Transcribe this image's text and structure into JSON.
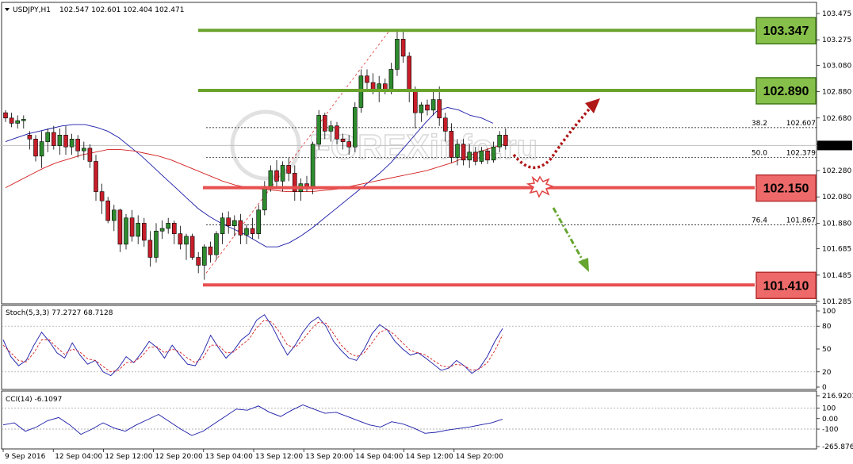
{
  "chart_data": {
    "type": "candlestick",
    "main": {
      "symbol_header": "USDJPY,H1",
      "ohlc_header": "102.547 102.601 102.404 102.471",
      "current_price": "102.471",
      "ylim": [
        101.285,
        103.475
      ],
      "y_ticks": [
        "103.475",
        "103.275",
        "103.080",
        "102.880",
        "102.680",
        "102.480",
        "102.280",
        "102.080",
        "101.880",
        "101.685",
        "101.485",
        "101.285"
      ],
      "candles": [
        [
          102.72,
          102.74,
          102.65,
          102.68
        ],
        [
          102.68,
          102.72,
          102.61,
          102.64
        ],
        [
          102.64,
          102.7,
          102.6,
          102.66
        ],
        [
          102.66,
          102.7,
          102.6,
          102.67
        ],
        [
          102.55,
          102.58,
          102.44,
          102.52
        ],
        [
          102.52,
          102.55,
          102.35,
          102.39
        ],
        [
          102.39,
          102.58,
          102.3,
          102.5
        ],
        [
          102.5,
          102.6,
          102.42,
          102.57
        ],
        [
          102.57,
          102.62,
          102.44,
          102.47
        ],
        [
          102.47,
          102.6,
          102.4,
          102.55
        ],
        [
          102.55,
          102.62,
          102.4,
          102.46
        ],
        [
          102.46,
          102.56,
          102.4,
          102.52
        ],
        [
          102.52,
          102.55,
          102.38,
          102.43
        ],
        [
          102.43,
          102.5,
          102.36,
          102.45
        ],
        [
          102.45,
          102.48,
          102.3,
          102.35
        ],
        [
          102.35,
          102.4,
          102.05,
          102.12
        ],
        [
          102.12,
          102.18,
          101.95,
          102.05
        ],
        [
          102.05,
          102.08,
          101.88,
          101.9
        ],
        [
          101.9,
          102.02,
          101.82,
          101.98
        ],
        [
          101.98,
          101.99,
          101.66,
          101.72
        ],
        [
          101.72,
          101.95,
          101.68,
          101.92
        ],
        [
          101.92,
          101.98,
          101.74,
          101.78
        ],
        [
          101.78,
          101.94,
          101.72,
          101.88
        ],
        [
          101.88,
          101.92,
          101.7,
          101.75
        ],
        [
          101.75,
          101.82,
          101.55,
          101.62
        ],
        [
          101.62,
          101.88,
          101.58,
          101.82
        ],
        [
          101.82,
          101.9,
          101.76,
          101.84
        ],
        [
          101.84,
          101.92,
          101.8,
          101.88
        ],
        [
          101.88,
          101.9,
          101.72,
          101.8
        ],
        [
          101.8,
          101.86,
          101.68,
          101.72
        ],
        [
          101.72,
          101.8,
          101.6,
          101.78
        ],
        [
          101.78,
          101.8,
          101.6,
          101.62
        ],
        [
          101.62,
          101.66,
          101.5,
          101.56
        ],
        [
          101.56,
          101.72,
          101.45,
          101.7
        ],
        [
          101.7,
          101.74,
          101.58,
          101.64
        ],
        [
          101.64,
          101.82,
          101.6,
          101.8
        ],
        [
          101.8,
          101.96,
          101.72,
          101.92
        ],
        [
          101.92,
          101.97,
          101.8,
          101.86
        ],
        [
          101.86,
          101.94,
          101.78,
          101.9
        ],
        [
          101.9,
          101.95,
          101.72,
          101.79
        ],
        [
          101.79,
          101.87,
          101.72,
          101.84
        ],
        [
          101.84,
          101.92,
          101.76,
          101.8
        ],
        [
          101.8,
          102.02,
          101.76,
          101.98
        ],
        [
          101.98,
          102.2,
          101.94,
          102.16
        ],
        [
          102.16,
          102.32,
          102.12,
          102.28
        ],
        [
          102.28,
          102.36,
          102.14,
          102.2
        ],
        [
          102.2,
          102.35,
          102.12,
          102.32
        ],
        [
          102.32,
          102.38,
          102.2,
          102.26
        ],
        [
          102.26,
          102.32,
          102.05,
          102.12
        ],
        [
          102.12,
          102.22,
          102.05,
          102.18
        ],
        [
          102.18,
          102.24,
          102.12,
          102.14
        ],
        [
          102.14,
          102.5,
          102.1,
          102.48
        ],
        [
          102.48,
          102.74,
          102.44,
          102.7
        ],
        [
          102.7,
          102.72,
          102.52,
          102.58
        ],
        [
          102.58,
          102.66,
          102.5,
          102.62
        ],
        [
          102.62,
          102.65,
          102.48,
          102.52
        ],
        [
          102.52,
          102.56,
          102.44,
          102.5
        ],
        [
          102.5,
          102.55,
          102.4,
          102.46
        ],
        [
          102.46,
          102.8,
          102.42,
          102.76
        ],
        [
          102.76,
          103.05,
          102.72,
          103.0
        ],
        [
          103.0,
          103.05,
          102.9,
          102.95
        ],
        [
          102.95,
          103.02,
          102.86,
          102.88
        ],
        [
          102.88,
          103.0,
          102.8,
          102.94
        ],
        [
          102.94,
          102.98,
          102.86,
          102.9
        ],
        [
          102.9,
          103.1,
          102.86,
          103.05
        ],
        [
          103.05,
          103.35,
          103.0,
          103.28
        ],
        [
          103.28,
          103.35,
          103.1,
          103.15
        ],
        [
          103.15,
          103.18,
          102.8,
          102.9
        ],
        [
          102.9,
          102.92,
          102.6,
          102.72
        ],
        [
          102.72,
          102.8,
          102.65,
          102.78
        ],
        [
          102.78,
          102.82,
          102.7,
          102.74
        ],
        [
          102.74,
          102.88,
          102.7,
          102.82
        ],
        [
          102.82,
          102.92,
          102.62,
          102.68
        ],
        [
          102.68,
          102.72,
          102.5,
          102.58
        ],
        [
          102.58,
          102.64,
          102.34,
          102.38
        ],
        [
          102.38,
          102.52,
          102.32,
          102.48
        ],
        [
          102.48,
          102.52,
          102.32,
          102.36
        ],
        [
          102.36,
          102.48,
          102.3,
          102.42
        ],
        [
          102.42,
          102.46,
          102.32,
          102.35
        ],
        [
          102.35,
          102.46,
          102.33,
          102.43
        ],
        [
          102.43,
          102.45,
          102.33,
          102.36
        ],
        [
          102.36,
          102.5,
          102.34,
          102.46
        ],
        [
          102.46,
          102.58,
          102.42,
          102.55
        ],
        [
          102.55,
          102.6,
          102.44,
          102.47
        ]
      ],
      "ma_blue": [
        102.5,
        102.53,
        102.56,
        102.58,
        102.6,
        102.62,
        102.63,
        102.63,
        102.61,
        102.58,
        102.53,
        102.46,
        102.39,
        102.31,
        102.23,
        102.15,
        102.07,
        101.99,
        101.93,
        101.88,
        101.84,
        101.8,
        101.75,
        101.7,
        101.7,
        101.73,
        101.78,
        101.84,
        101.91,
        101.98,
        102.05,
        102.12,
        102.19,
        102.26,
        102.34,
        102.44,
        102.54,
        102.64,
        102.73,
        102.76,
        102.74,
        102.7,
        102.68,
        102.64
      ],
      "ma_red": [
        102.15,
        102.2,
        102.25,
        102.3,
        102.34,
        102.37,
        102.4,
        102.42,
        102.44,
        102.44,
        102.43,
        102.41,
        102.39,
        102.36,
        102.32,
        102.28,
        102.24,
        102.2,
        102.17,
        102.15,
        102.14,
        102.13,
        102.12,
        102.12,
        102.12,
        102.13,
        102.14,
        102.16,
        102.18,
        102.2,
        102.22,
        102.24,
        102.26,
        102.28,
        102.31,
        102.34,
        102.38,
        102.42,
        102.45,
        102.48
      ],
      "levels": [
        {
          "label": "103.347",
          "value": 103.347,
          "kind": "resistance",
          "color": "#6aa32c"
        },
        {
          "label": "102.890",
          "value": 102.89,
          "kind": "resistance",
          "color": "#6aa32c"
        },
        {
          "label": "102.150",
          "value": 102.15,
          "kind": "support",
          "color": "#e85050"
        },
        {
          "label": "101.410",
          "value": 101.41,
          "kind": "support",
          "color": "#e85050"
        }
      ],
      "fib_levels": [
        {
          "ratio": "38.2",
          "price": "102.607",
          "value": 102.607
        },
        {
          "ratio": "50.0",
          "price": "102.379",
          "value": 102.379
        },
        {
          "ratio": "76.4",
          "price": "101.867",
          "value": 101.867
        }
      ],
      "watermark": "FOREXinfo.ru"
    },
    "stoch": {
      "label": "Stoch(5,3,3) 77.2727 68.7128",
      "ylim": [
        0,
        100
      ],
      "y_ticks": [
        "100",
        "80",
        "50",
        "20",
        "0"
      ],
      "main_line": [
        62,
        40,
        28,
        35,
        55,
        72,
        60,
        45,
        38,
        58,
        42,
        30,
        35,
        20,
        15,
        25,
        40,
        32,
        45,
        60,
        52,
        38,
        55,
        42,
        30,
        28,
        45,
        68,
        52,
        38,
        48,
        62,
        70,
        88,
        95,
        80,
        60,
        42,
        55,
        72,
        85,
        92,
        80,
        60,
        48,
        38,
        35,
        50,
        70,
        82,
        75,
        60,
        50,
        42,
        45,
        38,
        30,
        22,
        25,
        35,
        28,
        18,
        25,
        40,
        60,
        77
      ],
      "signal_line": [
        55,
        45,
        35,
        33,
        45,
        62,
        62,
        52,
        43,
        50,
        46,
        37,
        35,
        27,
        20,
        22,
        32,
        33,
        40,
        52,
        53,
        45,
        50,
        46,
        38,
        32,
        38,
        55,
        55,
        45,
        46,
        55,
        63,
        78,
        88,
        85,
        72,
        55,
        52,
        62,
        75,
        85,
        84,
        70,
        55,
        45,
        40,
        45,
        58,
        72,
        76,
        68,
        58,
        48,
        45,
        42,
        35,
        28,
        26,
        30,
        28,
        22,
        24,
        32,
        48,
        68.7
      ],
      "dashed_levels": [
        80,
        20
      ]
    },
    "cci": {
      "label": "CCI(14) -6.1097",
      "ylim": [
        -265.8767,
        216.9201
      ],
      "y_ticks": [
        "216.9201",
        "100",
        "0.00",
        "-100",
        "-265.8767"
      ],
      "values": [
        -60,
        -40,
        -120,
        -80,
        -20,
        10,
        -60,
        -150,
        -100,
        -40,
        -90,
        -120,
        -60,
        -10,
        40,
        -30,
        -100,
        -160,
        -120,
        -50,
        20,
        90,
        80,
        120,
        60,
        20,
        80,
        130,
        90,
        50,
        60,
        20,
        -20,
        -60,
        -80,
        -30,
        -50,
        -90,
        -140,
        -130,
        -110,
        -95,
        -80,
        -60,
        -40,
        -6.1097
      ],
      "dashed_levels": [
        100,
        -100
      ]
    },
    "x_ticks": [
      "9 Sep 2016",
      "12 Sep 04:00",
      "12 Sep 12:00",
      "12 Sep 20:00",
      "13 Sep 04:00",
      "13 Sep 12:00",
      "13 Sep 20:00",
      "14 Sep 04:00",
      "14 Sep 12:00",
      "14 Sep 20:00"
    ]
  }
}
